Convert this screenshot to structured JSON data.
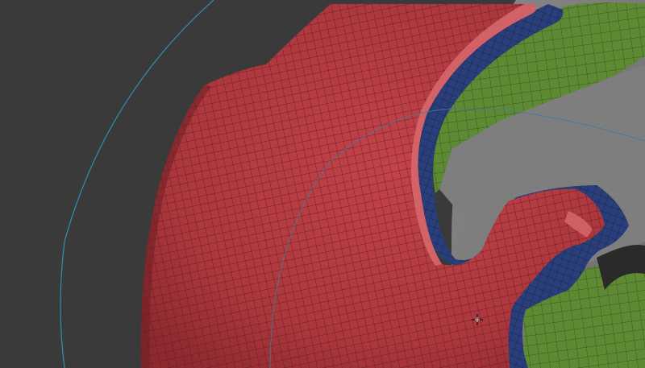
{
  "viewport": {
    "background_color": "#3a3a3a",
    "gizmo_ring_color": "#2f8fb5"
  },
  "materials": {
    "polygroup_red": "#b0393f",
    "polygroup_blue": "#2a3f7a",
    "polygroup_green": "#5f8a34",
    "backface_gray": "#7b7b7b",
    "wire_color": "#5a1518"
  },
  "cursor": {
    "icon": "crosshair-cursor-icon"
  }
}
